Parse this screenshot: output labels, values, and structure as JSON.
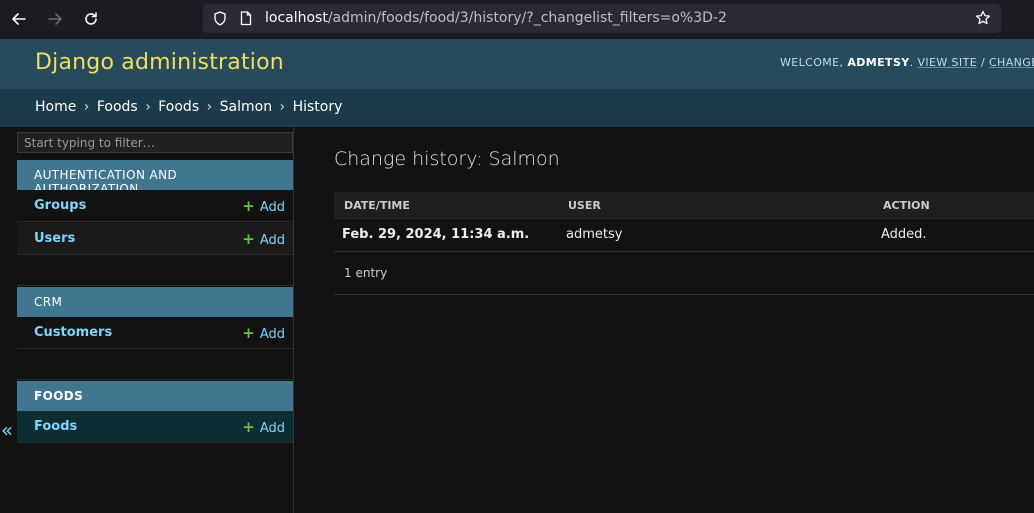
{
  "browser": {
    "url_host": "localhost",
    "url_path": "/admin/foods/food/3/history/?_changelist_filters=o%3D-2"
  },
  "header": {
    "site_title": "Django administration",
    "welcome": "WELCOME,",
    "username": "ADMETSY",
    "view_site": "VIEW SITE",
    "separator": "/",
    "change_password": "CHANGE PA"
  },
  "breadcrumbs": {
    "items": [
      "Home",
      "Foods",
      "Foods",
      "Salmon"
    ],
    "current": "History",
    "separator": "›"
  },
  "sidebar": {
    "filter_placeholder": "Start typing to filter…",
    "add_label": "Add",
    "collapse_label": "«",
    "modules": [
      {
        "caption": "AUTHENTICATION AND AUTHORIZATION",
        "models": [
          "Groups",
          "Users"
        ]
      },
      {
        "caption": "CRM",
        "models": [
          "Customers"
        ]
      },
      {
        "caption": "FOODS",
        "models": [
          "Foods"
        ]
      }
    ]
  },
  "main": {
    "title": "Change history: Salmon",
    "columns": [
      "DATE/TIME",
      "USER",
      "ACTION"
    ],
    "rows": [
      {
        "datetime": "Feb. 29, 2024, 11:34 a.m.",
        "user": "admetsy",
        "action": "Added."
      }
    ],
    "entry_count": "1 entry"
  },
  "colors": {
    "header_bg": "#264b5d",
    "breadcrumb_bg": "#1c3b4a",
    "module_caption_bg": "#417690",
    "site_title": "#f5dd5d",
    "link": "#81d4fa",
    "add_plus": "#6cc04a"
  }
}
